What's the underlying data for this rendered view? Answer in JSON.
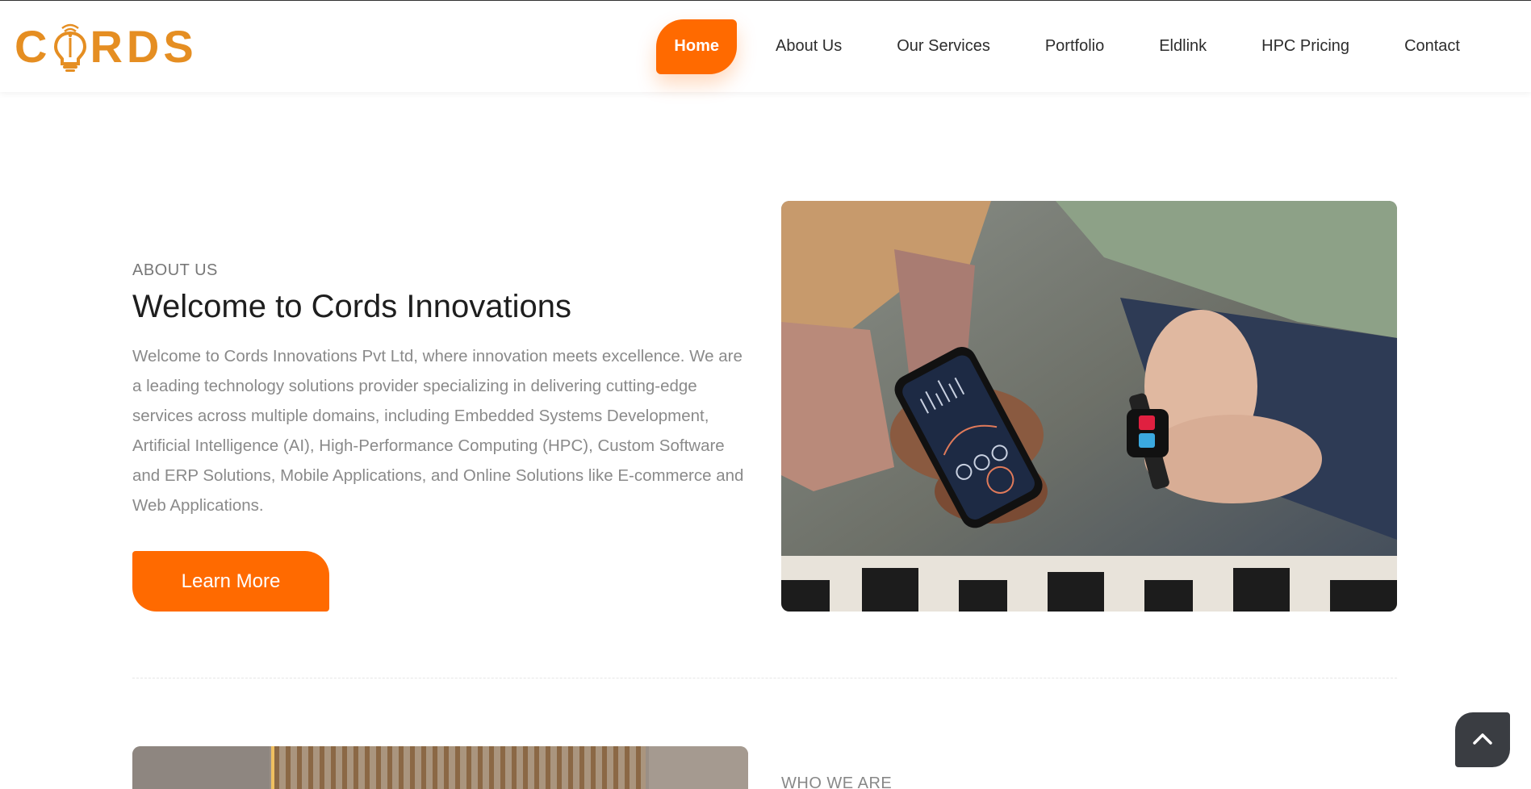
{
  "brand": {
    "logo_text_left": "C",
    "logo_text_right": "RDS",
    "logo_color": "#e58e22"
  },
  "nav": {
    "items": [
      {
        "label": "Home",
        "active": true
      },
      {
        "label": "About Us",
        "active": false
      },
      {
        "label": "Our Services",
        "active": false
      },
      {
        "label": "Portfolio",
        "active": false
      },
      {
        "label": "Eldlink",
        "active": false
      },
      {
        "label": "HPC Pricing",
        "active": false
      },
      {
        "label": "Contact",
        "active": false
      }
    ]
  },
  "about": {
    "eyebrow": "ABOUT US",
    "title": "Welcome to Cords Innovations",
    "body": "Welcome to Cords Innovations Pvt Ltd, where innovation meets excellence. We are a leading technology solutions provider specializing in delivering cutting-edge services across multiple domains, including Embedded Systems Development, Artificial Intelligence (AI), High-Performance Computing (HPC), Custom Software and ERP Solutions, Mobile Applications, and Online Solutions like E-commerce and Web Applications.",
    "cta_label": "Learn More"
  },
  "who": {
    "eyebrow": "WHO WE ARE"
  },
  "colors": {
    "accent": "#ff6a00",
    "logo": "#e58e22",
    "scroll_button": "#3a3d42"
  },
  "icons": {
    "scroll_top": "chevron-up-icon",
    "logo_bulb": "lightbulb-icon"
  }
}
